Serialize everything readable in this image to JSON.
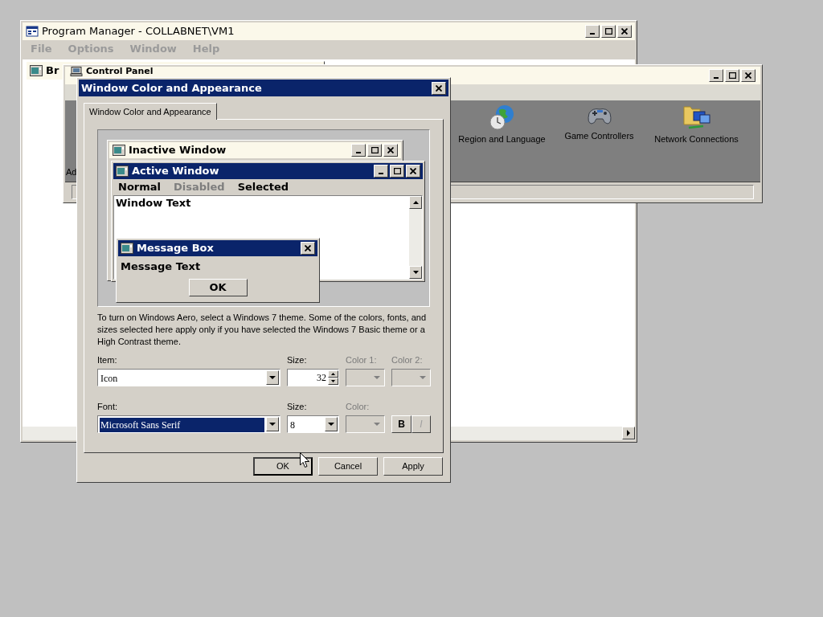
{
  "program_manager": {
    "title": "Program Manager - COLLABNET\\VM1",
    "active": false,
    "menu": [
      {
        "label": "File",
        "disabled": true
      },
      {
        "label": "Options",
        "disabled": true
      },
      {
        "label": "Window",
        "disabled": true
      },
      {
        "label": "Help",
        "disabled": true
      }
    ],
    "child_window": {
      "title": "Br"
    }
  },
  "control_panel": {
    "title": "Control Panel",
    "active": false,
    "side_text": "Ad",
    "items": [
      {
        "label": "Region and Language"
      },
      {
        "label": "Game Controllers"
      },
      {
        "label": "Network Connections"
      }
    ]
  },
  "dialog": {
    "title": "Window Color and Appearance",
    "active": true,
    "tabs": [
      {
        "label": "Window Color and Appearance",
        "selected": true
      }
    ],
    "preview": {
      "inactive_title": "Inactive Window",
      "active_title": "Active Window",
      "menu": [
        {
          "label": "Normal",
          "kind": "normal"
        },
        {
          "label": "Disabled",
          "kind": "disabled"
        },
        {
          "label": "Selected",
          "kind": "selected"
        }
      ],
      "window_text": "Window Text",
      "message_box": {
        "title": "Message Box",
        "text": "Message Text",
        "button": "OK"
      }
    },
    "description": "To turn on Windows Aero, select a Windows 7 theme.  Some of the colors, fonts, and sizes selected here apply only if you have selected the Windows 7 Basic theme or a High Contrast theme.",
    "item": {
      "label": "Item:",
      "value": "Icon"
    },
    "item_size": {
      "label": "Size:",
      "value": "32"
    },
    "color_1": {
      "label": "Color 1:",
      "disabled": true
    },
    "color_2": {
      "label": "Color 2:",
      "disabled": true
    },
    "font": {
      "label": "Font:",
      "value": "Microsoft Sans Serif",
      "selected": true
    },
    "font_size": {
      "label": "Size:",
      "value": "8"
    },
    "font_color": {
      "label": "Color:",
      "disabled": true
    },
    "bold": {
      "label": "B",
      "disabled": false
    },
    "italic": {
      "label": "I",
      "disabled": true
    },
    "buttons": [
      {
        "label": "OK",
        "default": true
      },
      {
        "label": "Cancel",
        "default": false
      },
      {
        "label": "Apply",
        "default": false
      }
    ]
  }
}
